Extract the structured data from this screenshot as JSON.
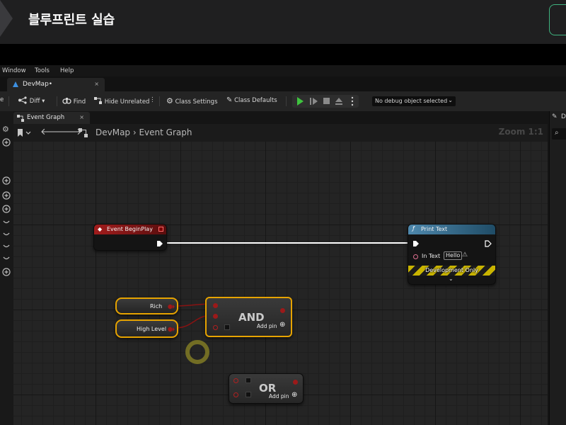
{
  "banner": {
    "title": "블루프린트 실습"
  },
  "menubar": {
    "items": [
      "Window",
      "Tools",
      "Help"
    ]
  },
  "document_tab": {
    "label": "DevMap•",
    "close": "×"
  },
  "toolbar": {
    "clipped_left": "e",
    "diff": "Diff",
    "find": "Find",
    "hide_unrelated": "Hide Unrelated",
    "class_settings": "Class Settings",
    "class_defaults": "Class Defaults",
    "debug_select": "No debug object selected"
  },
  "graph_tab": {
    "label": "Event Graph",
    "close": "×"
  },
  "graph_header": {
    "breadcrumb": "DevMap  ›  Event Graph",
    "zoom": "Zoom 1:1"
  },
  "right_panel": {
    "clipped_label": "D"
  },
  "nodes": {
    "event_begin_play": {
      "title": "Event BeginPlay",
      "color": "#8c1a1a"
    },
    "print_text": {
      "title": "Print Text",
      "in_text_label": "In Text",
      "in_text_value": "Hello",
      "footer": "Development Only",
      "color": "#3a6f8f"
    },
    "rich": {
      "label": "Rich"
    },
    "high_level": {
      "label": "High Level"
    },
    "and_node": {
      "label": "AND",
      "add_pin": "Add pin"
    },
    "or_node": {
      "label": "OR",
      "add_pin": "Add pin"
    }
  },
  "colors": {
    "selection": "#e6a300",
    "bool_pin": "#9b1a1a",
    "accent_green": "#3fb37f"
  }
}
